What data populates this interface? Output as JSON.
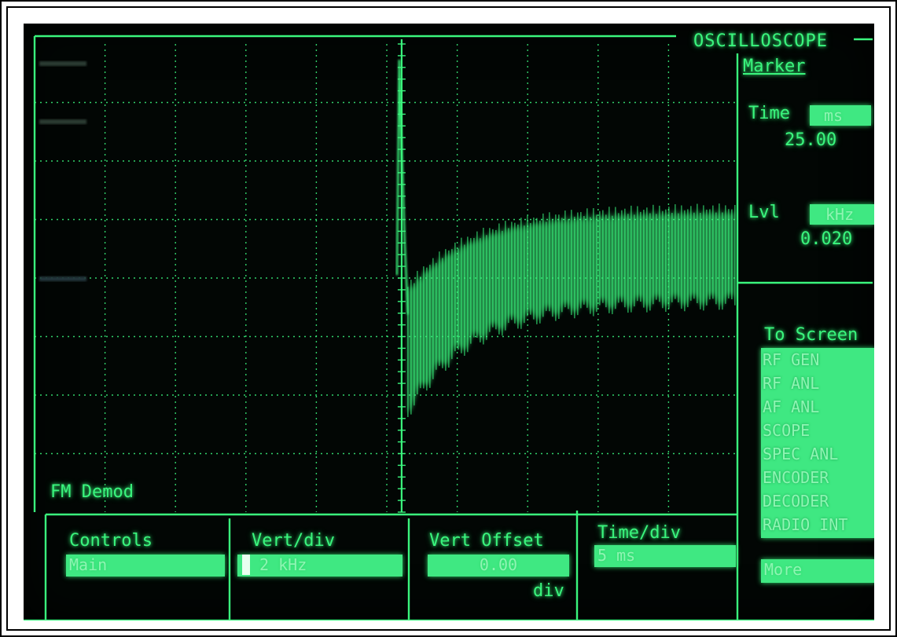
{
  "header": {
    "title": "OSCILLOSCOPE",
    "menu_title": "Marker"
  },
  "marker": {
    "time_label": "Time",
    "time_unit": "ms",
    "time_value": "25.00",
    "level_label": "Lvl",
    "level_unit": "kHz",
    "level_value": "0.020"
  },
  "to_screen": {
    "title": "To Screen",
    "items": [
      "RF GEN",
      "RF ANL",
      "AF ANL",
      "SCOPE",
      "SPEC ANL",
      "ENCODER",
      "DECODER",
      "RADIO INT"
    ],
    "more_label": "More"
  },
  "trace": {
    "label": "FM Demod"
  },
  "controls": {
    "controls_label": "Controls",
    "controls_value": "Main",
    "vert_div_label": "Vert/div",
    "vert_div_value": "2 kHz",
    "vert_offset_label": "Vert Offset",
    "vert_offset_value": "0.00",
    "vert_offset_unit": "div",
    "time_div_label": "Time/div",
    "time_div_value": "5 ms"
  },
  "colors": {
    "phosphor": "#3af57d",
    "background": "#020604",
    "highlight": "#3fe882"
  }
}
